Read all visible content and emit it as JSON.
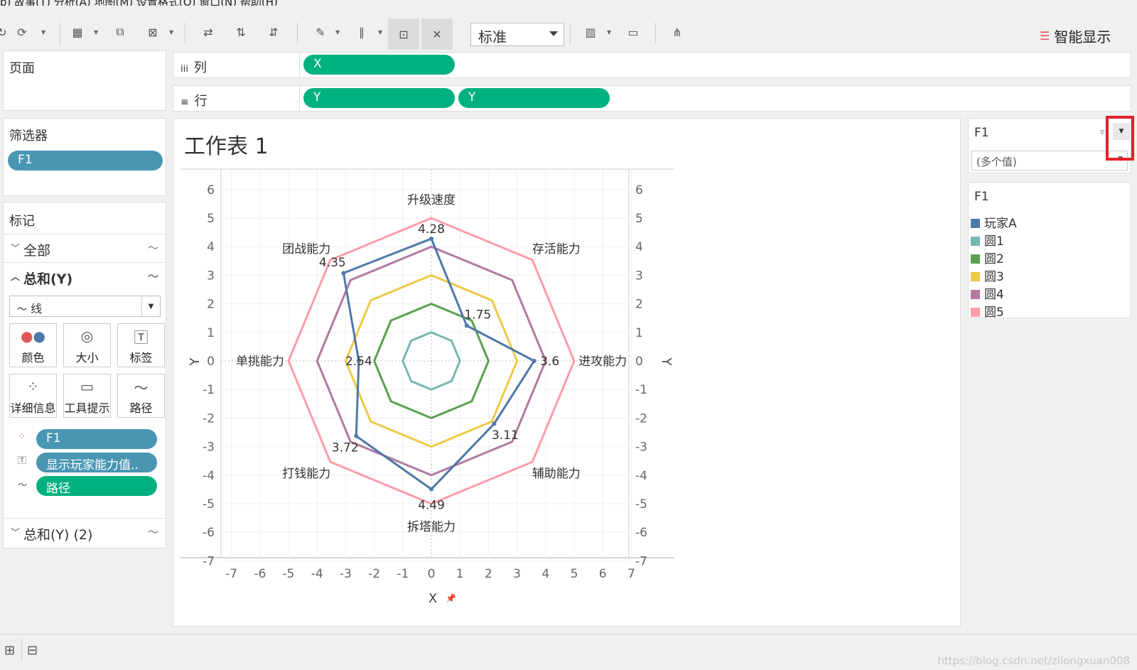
{
  "menu": "b)   故事(T)   分析(A)   地图(M)   设置格式(O)   窗口(N)   帮助(H)",
  "toolbar": {
    "mark_type_select": "标准",
    "smart_show": "智能显示"
  },
  "pages_title": "页面",
  "columns_shelf": {
    "label": "列",
    "pills": [
      "X"
    ]
  },
  "rows_shelf": {
    "label": "行",
    "pills": [
      "Y",
      "Y"
    ]
  },
  "filters": {
    "title": "筛选器",
    "pills": [
      "F1"
    ]
  },
  "marks": {
    "title": "标记",
    "all_label": "全部",
    "sum_y_label": "总和(Y)",
    "mark_type": "线",
    "cards": [
      "颜色",
      "大小",
      "标签",
      "详细信息",
      "工具提示",
      "路径"
    ],
    "pills": [
      "F1",
      "显示玩家能力值..",
      "路径"
    ],
    "sum_y2_label": "总和(Y) (2)"
  },
  "sheet": {
    "title": "工作表 1"
  },
  "filter_card": {
    "title": "F1",
    "value": "(多个值)"
  },
  "legend": {
    "title": "F1",
    "items": [
      {
        "label": "玩家A",
        "color": "#4e79a7"
      },
      {
        "label": "圆1",
        "color": "#76b7b2"
      },
      {
        "label": "圆2",
        "color": "#59a14f"
      },
      {
        "label": "圆3",
        "color": "#edc948"
      },
      {
        "label": "圆4",
        "color": "#b07aa1"
      },
      {
        "label": "圆5",
        "color": "#ff9da7"
      }
    ]
  },
  "watermark": "https://blog.csdn.net/zilongxuan008",
  "chart_data": {
    "type": "radar",
    "axes": [
      "升级速度",
      "存活能力",
      "进攻能力",
      "辅助能力",
      "拆塔能力",
      "打钱能力",
      "单挑能力",
      "团战能力"
    ],
    "rings": [
      {
        "name": "圆1",
        "radius": 1,
        "color": "#76b7b2"
      },
      {
        "name": "圆2",
        "radius": 2,
        "color": "#59a14f"
      },
      {
        "name": "圆3",
        "radius": 3,
        "color": "#edc948"
      },
      {
        "name": "圆4",
        "radius": 4,
        "color": "#b07aa1"
      },
      {
        "name": "圆5",
        "radius": 5,
        "color": "#ff9da7"
      }
    ],
    "series": [
      {
        "name": "玩家A",
        "color": "#4e79a7",
        "values": [
          4.28,
          1.75,
          3.6,
          3.11,
          4.49,
          3.72,
          2.54,
          4.35
        ]
      }
    ],
    "xlabel": "X",
    "ylabel": "Y",
    "xlim": [
      -7,
      7
    ],
    "ylim": [
      -7,
      7
    ],
    "xticks": [
      -7,
      -6,
      -5,
      -4,
      -3,
      -2,
      -1,
      0,
      1,
      2,
      3,
      4,
      5,
      6,
      7
    ],
    "yticks": [
      -7,
      -6,
      -5,
      -4,
      -3,
      -2,
      -1,
      0,
      1,
      2,
      3,
      4,
      5,
      6,
      7
    ]
  }
}
